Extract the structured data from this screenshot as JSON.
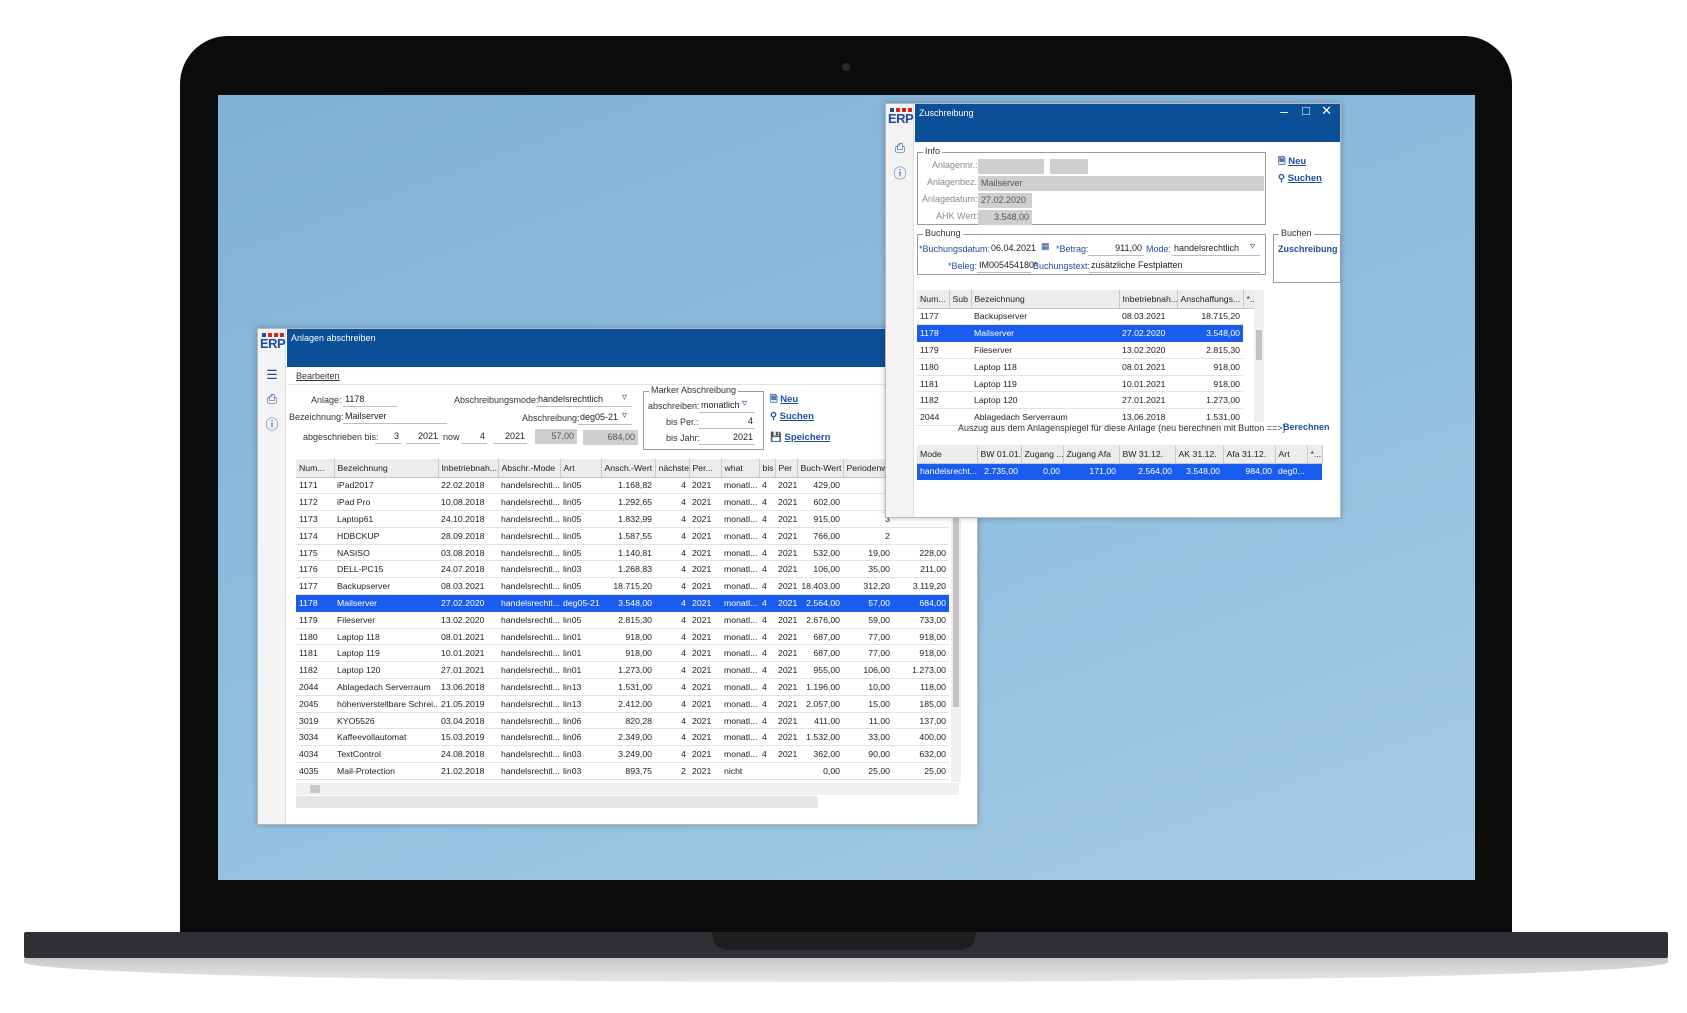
{
  "brand": {
    "logo_text": "ERP"
  },
  "win1": {
    "title": "Anlagen abschreiben",
    "menu": "Bearbeiten",
    "form": {
      "anlage_label": "Anlage:",
      "anlage_value": "1178",
      "bez_label": "Bezeichnung:",
      "bez_value": "Mailserver",
      "abmode_label": "Abschreibungsmode:",
      "abmode_value": "handelsrechtlich",
      "ab_label": "Abschreibung:",
      "ab_value": "deg05-21",
      "abgeschr_label": "abgeschrieben bis:",
      "abgeschr_per": "3",
      "abgeschr_year": "2021",
      "now_label": "now",
      "now_per": "4",
      "now_year": "2021",
      "ro1": "57,00",
      "ro2": "684,00"
    },
    "marker": {
      "title": "Marker Abschreibung",
      "abschr_label": "abschreiben:",
      "abschr_value": "monatlich",
      "bisper_label": "bis Per.:",
      "bisper_value": "4",
      "bisjahr_label": "bis Jahr:",
      "bisjahr_value": "2021"
    },
    "buttons": {
      "neu": "Neu",
      "suchen": "Suchen",
      "speichern": "Speichern"
    },
    "columns": [
      "Num...",
      "Bezeichnung",
      "Inbetriebnah...",
      "Abschr.-Mode",
      "Art",
      "Ansch.-Wert",
      "nächste",
      "Per...",
      "what",
      "bis",
      "Per",
      "Buch-Wert",
      "Periodenw..."
    ],
    "rows": [
      [
        "1171",
        "iPad2017",
        "22.02.2018",
        "handelsrechtl...",
        "lin05",
        "1.168,82",
        "4",
        "2021",
        "monatl...",
        "4",
        "2021",
        "429,00",
        "1",
        ""
      ],
      [
        "1172",
        "iPad Pro",
        "10.08.2018",
        "handelsrechtl...",
        "lin05",
        "1.292,65",
        "4",
        "2021",
        "monatl...",
        "4",
        "2021",
        "602,00",
        "2",
        ""
      ],
      [
        "1173",
        "Laptop61",
        "24.10.2018",
        "handelsrechtl...",
        "lin05",
        "1.832,99",
        "4",
        "2021",
        "monatl...",
        "4",
        "2021",
        "915,00",
        "3",
        ""
      ],
      [
        "1174",
        "HDBCKUP",
        "28.09.2018",
        "handelsrechtl...",
        "lin05",
        "1.587,55",
        "4",
        "2021",
        "monatl...",
        "4",
        "2021",
        "766,00",
        "2",
        ""
      ],
      [
        "1175",
        "NASISO",
        "03.08.2018",
        "handelsrechtl...",
        "lin05",
        "1.140,81",
        "4",
        "2021",
        "monatl...",
        "4",
        "2021",
        "532,00",
        "19,00",
        "228,00"
      ],
      [
        "1176",
        "DELL-PC15",
        "24.07.2018",
        "handelsrechtl...",
        "lin03",
        "1.268,83",
        "4",
        "2021",
        "monatl...",
        "4",
        "2021",
        "106,00",
        "35,00",
        "211,00"
      ],
      [
        "1177",
        "Backupserver",
        "08.03.2021",
        "handelsrechtl...",
        "lin05",
        "18.715,20",
        "4",
        "2021",
        "monatl...",
        "4",
        "2021",
        "18.403,00",
        "312,20",
        "3.119,20"
      ],
      [
        "1178",
        "Mailserver",
        "27.02.2020",
        "handelsrechtl...",
        "deg05-21",
        "3.548,00",
        "4",
        "2021",
        "monatl...",
        "4",
        "2021",
        "2.564,00",
        "57,00",
        "684,00"
      ],
      [
        "1179",
        "Fileserver",
        "13.02.2020",
        "handelsrechtl...",
        "lin05",
        "2.815,30",
        "4",
        "2021",
        "monatl...",
        "4",
        "2021",
        "2.676,00",
        "59,00",
        "733,00"
      ],
      [
        "1180",
        "Laptop 118",
        "08.01.2021",
        "handelsrechtl...",
        "lin01",
        "918,00",
        "4",
        "2021",
        "monatl...",
        "4",
        "2021",
        "687,00",
        "77,00",
        "918,00"
      ],
      [
        "1181",
        "Laptop 119",
        "10.01.2021",
        "handelsrechtl...",
        "lin01",
        "918,00",
        "4",
        "2021",
        "monatl...",
        "4",
        "2021",
        "687,00",
        "77,00",
        "918,00"
      ],
      [
        "1182",
        "Laptop 120",
        "27.01.2021",
        "handelsrechtl...",
        "lin01",
        "1.273,00",
        "4",
        "2021",
        "monatl...",
        "4",
        "2021",
        "955,00",
        "106,00",
        "1.273,00"
      ],
      [
        "2044",
        "Ablagedach Serverraum",
        "13.06.2018",
        "handelsrechtl...",
        "lin13",
        "1.531,00",
        "4",
        "2021",
        "monatl...",
        "4",
        "2021",
        "1.196,00",
        "10,00",
        "118,00"
      ],
      [
        "2045",
        "höhenverstellbare Schrei...",
        "21.05.2019",
        "handelsrechtl...",
        "lin13",
        "2.412,00",
        "4",
        "2021",
        "monatl...",
        "4",
        "2021",
        "2.057,00",
        "15,00",
        "185,00"
      ],
      [
        "3019",
        "KYO5526",
        "03.04.2018",
        "handelsrechtl...",
        "lin06",
        "820,28",
        "4",
        "2021",
        "monatl...",
        "4",
        "2021",
        "411,00",
        "11,00",
        "137,00"
      ],
      [
        "3034",
        "Kaffeevollautomat",
        "15.03.2019",
        "handelsrechtl...",
        "lin06",
        "2.349,00",
        "4",
        "2021",
        "monatl...",
        "4",
        "2021",
        "1.532,00",
        "33,00",
        "400,00"
      ],
      [
        "4034",
        "TextControl",
        "24.08.2018",
        "handelsrechtl...",
        "lin03",
        "3.249,00",
        "4",
        "2021",
        "monatl...",
        "4",
        "2021",
        "362,00",
        "90,00",
        "632,00"
      ],
      [
        "4035",
        "Mail-Protection",
        "21.02.2018",
        "handelsrechtl...",
        "lin03",
        "893,75",
        "2",
        "2021",
        "nicht",
        "",
        "",
        "0,00",
        "25,00",
        "25,00"
      ]
    ]
  },
  "win2": {
    "title": "Zuschreibung",
    "info": {
      "title": "Info",
      "anlagennr_label": "Anlagennr.:",
      "anlagennr_value": "",
      "anlagennr_sub": "",
      "anlagebez_label": "Anlagenbez.:",
      "anlagebez_value": "Mailserver",
      "anlagedatum_label": "Anlagedatum:",
      "anlagedatum_value": "27.02.2020",
      "ahk_label": "AHK Wert:",
      "ahk_value": "3.548,00"
    },
    "buchung": {
      "title": "Buchung",
      "datum_label": "*Buchungsdatum:",
      "datum_value": "06.04.2021",
      "betrag_label": "*Betrag:",
      "betrag_value": "911,00",
      "mode_label": "Mode:",
      "mode_value": "handelsrechtlich",
      "beleg_label": "*Beleg:",
      "beleg_value": "IM005454180*",
      "text_label": "Buchungstext:",
      "text_value": "zusätzliche Festplatten"
    },
    "buttons": {
      "neu": "Neu",
      "suchen": "Suchen",
      "buchen_group": "Buchen",
      "zuschreibung": "Zuschreibung",
      "berechnen": "Berechnen"
    },
    "columns": [
      "Num...",
      "Sub",
      "Bezeichnung",
      "Inbetriebnah...",
      "Anschaffungs...",
      "*..."
    ],
    "rows": [
      [
        "1177",
        "",
        "Backupserver",
        "08.03.2021",
        "18.715,20"
      ],
      [
        "1178",
        "",
        "Mailserver",
        "27.02.2020",
        "3.548,00"
      ],
      [
        "1179",
        "",
        "Fileserver",
        "13.02.2020",
        "2.815,30"
      ],
      [
        "1180",
        "",
        "Laptop 118",
        "08.01.2021",
        "918,00"
      ],
      [
        "1181",
        "",
        "Laptop 119",
        "10.01.2021",
        "918,00"
      ],
      [
        "1182",
        "",
        "Laptop 120",
        "27.01.2021",
        "1.273,00"
      ],
      [
        "2044",
        "",
        "Ablagedach Serverraum",
        "13.06.2018",
        "1.531,00"
      ]
    ],
    "auszug_text": "Auszug aus dem Anlagenspiegel für diese Anlage (neu berechnen mit Button ==>)",
    "spiegel_columns": [
      "Mode",
      "BW 01.01.",
      "Zugang ...",
      "Zugang Afa",
      "BW 31.12.",
      "AK 31.12.",
      "Afa 31.12.",
      "Art",
      "*..."
    ],
    "spiegel_rows": [
      [
        "handelsrecht...",
        "2.735,00",
        "0,00",
        "171,00",
        "2.564,00",
        "3.548,00",
        "984,00",
        "deg0...",
        ""
      ]
    ]
  }
}
